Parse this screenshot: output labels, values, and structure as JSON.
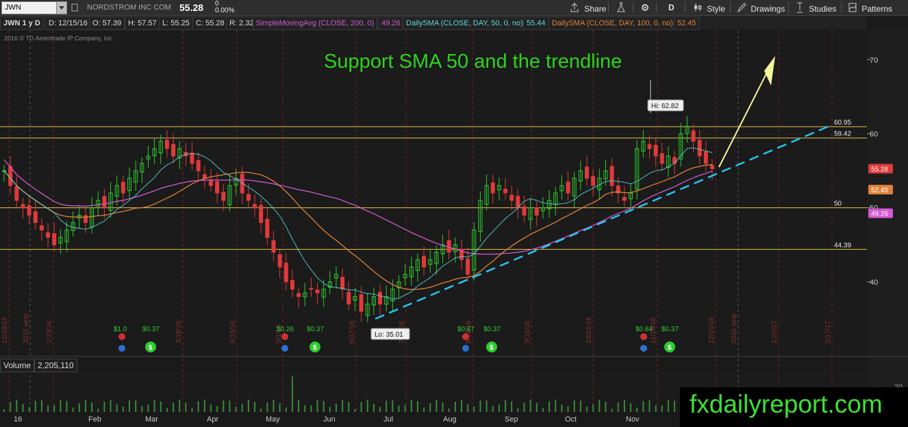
{
  "toolbar": {
    "symbol": "JWN",
    "company": "NORDSTROM INC COM",
    "last": "55.28",
    "change": "0",
    "pct": "0.00%",
    "share": "Share",
    "period": "D",
    "style": "Style",
    "drawings": "Drawings",
    "studies": "Studies",
    "patterns": "Patterns"
  },
  "info": {
    "chart_label": "JWN 1 y D",
    "date": "D: 12/15/16",
    "open": "O: 57.39",
    "high": "H: 57.57",
    "low": "L: 55.25",
    "close": "C: 55.28",
    "range": "R: 2.32",
    "sma200_label": "SimpleMovingAvg (CLOSE, 200, 0)",
    "sma200_value": "49.26",
    "sma50_label": "DailySMA (CLOSE, DAY, 50, 0, no)",
    "sma50_value": "55.44",
    "sma100_label": "DailySMA (CLOSE, DAY, 100, 0, no)",
    "sma100_value": "52.45"
  },
  "copyright": "2016 © TD Ameritrade IP Company, Inc.",
  "annotation": "Support SMA 50 and the trendline",
  "watermark": "fxdailyreport.com",
  "volume": {
    "label": "Volume",
    "value": "2,205,110"
  },
  "colors": {
    "up": "#2ecc2e",
    "down": "#e03a3a",
    "sma200": "#d25ad2",
    "sma50": "#5fd9e0",
    "sma100": "#e0823a",
    "level": "#e8c34a",
    "trendline": "#26c6f0",
    "arrow": "#f5f59a",
    "annotation": "#2fd21f"
  },
  "chart_data": {
    "type": "candlestick",
    "ylim": [
      30,
      74
    ],
    "y_ticks": [
      "40",
      "50",
      "60",
      "70"
    ],
    "x_months": [
      "16",
      "Feb",
      "Mar",
      "Apr",
      "May",
      "Jun",
      "Jul",
      "Aug",
      "Sep",
      "Oct",
      "Nov"
    ],
    "vertical_dates": [
      "12/18/15",
      "2015 year",
      "1/15/16",
      "3/18/16",
      "4/15/16",
      "5/1/16",
      "6/17/16",
      "7/15/16",
      "8/19/16",
      "9/16/16",
      "10/21/16",
      "11/18/16",
      "12/16/16",
      "2016 year",
      "1/20/17",
      "2/17/17"
    ],
    "ohlc_close": [
      55,
      53,
      51,
      50,
      49,
      48,
      47,
      46,
      45,
      46,
      47,
      48,
      49,
      48,
      50,
      51,
      50,
      52,
      53,
      52,
      54,
      55,
      56,
      57,
      58,
      59,
      58,
      57,
      58,
      57,
      56,
      55,
      54,
      53,
      52,
      51,
      53,
      54,
      52,
      51,
      50,
      48,
      46,
      44,
      42,
      40,
      39,
      38,
      38.5,
      39,
      38.5,
      39,
      40,
      41,
      39,
      37,
      38,
      36,
      37,
      38,
      37,
      38,
      39,
      40,
      41,
      42,
      43,
      42,
      43,
      44,
      45,
      44,
      45,
      43,
      41,
      47,
      51,
      53,
      52,
      53,
      52,
      51,
      50,
      49,
      50,
      49,
      50,
      51,
      52,
      53,
      52,
      54,
      55,
      54,
      53,
      54,
      55,
      53,
      52,
      51,
      52,
      58,
      59,
      58,
      57,
      56,
      57,
      56,
      60,
      61,
      59,
      57,
      56,
      55.28
    ],
    "levels": [
      "60.95",
      "59.42",
      "50",
      "44.39"
    ],
    "price_tags": [
      "55.28",
      "52.45",
      "49.26"
    ],
    "hi_label": "Hi: 62.82",
    "lo_label": "Lo: 35.01",
    "events": [
      {
        "label": "$1.0",
        "kind": "dividend"
      },
      {
        "label": "$0.37",
        "kind": "earnings"
      },
      {
        "label": "$0.26",
        "kind": "dividend"
      },
      {
        "label": "$0.37",
        "kind": "earnings"
      },
      {
        "label": "$0.67",
        "kind": "dividend"
      },
      {
        "label": "$0.37",
        "kind": "earnings"
      },
      {
        "label": "$0.84",
        "kind": "dividend"
      },
      {
        "label": "$0.37",
        "kind": "earnings"
      }
    ],
    "volume_right_tick": "20"
  }
}
